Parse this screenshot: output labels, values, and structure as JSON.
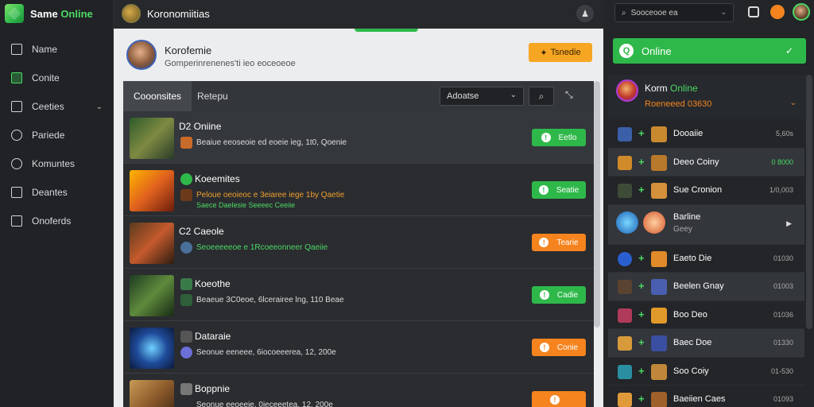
{
  "brand": {
    "name_part1": "Same ",
    "name_part2": "Online"
  },
  "sidebar": {
    "items": [
      {
        "label": "Name",
        "icon": "square-icon"
      },
      {
        "label": "Conite",
        "icon": "chart-icon"
      },
      {
        "label": "Ceeties",
        "icon": "home-icon",
        "has_chevron": true
      },
      {
        "label": "Pariede",
        "icon": "search-icon"
      },
      {
        "label": "Komuntes",
        "icon": "user-icon"
      },
      {
        "label": "Deantes",
        "icon": "document-icon"
      },
      {
        "label": "Onoferds",
        "icon": "phone-icon"
      }
    ]
  },
  "topbar": {
    "title": "Koronomiitias"
  },
  "profile": {
    "name": "Korofemie",
    "subtitle": "Gomperinrenenes'ti ieo eoceoeoe",
    "button_label": "Tsnedie"
  },
  "tabs": [
    {
      "label": "Cooonsites"
    },
    {
      "label": "Retepu"
    }
  ],
  "filter": {
    "select_value": "Adoatse"
  },
  "rows": [
    {
      "title": "D2 Oniine",
      "meta": "Beaiue eeoseoie ed eoeie ieg, 1t0, Qoenie",
      "meta2": "",
      "button": "Eetlo",
      "btn_color": "green",
      "selected": true
    },
    {
      "title": "Koeemites",
      "meta": "Peloue oeoieoc e 3eiaree iege 1by Qaetie",
      "meta2": "Saece Daelesie  Seeeec Ceeiie",
      "button": "Seatie",
      "btn_color": "green"
    },
    {
      "title": "C2 Caeole",
      "meta": "Seoeeeeeoe e 1Rcoeeonneer Qaeiie",
      "meta2": "",
      "button": "Tearie",
      "btn_color": "orange"
    },
    {
      "title": "Koeothe",
      "meta": "Beaeue 3C0eoe, 6lcerairee lng, 110 Beae",
      "meta2": "",
      "button": "Cadie",
      "btn_color": "green"
    },
    {
      "title": "Dataraie",
      "meta": "Seonue eeneee, 6iocoeeerea, 12, 200e",
      "meta2": "",
      "button": "Conie",
      "btn_color": "orange"
    },
    {
      "title": "Boppnie",
      "meta": "Seonue eeoeeie, 0ieceeetea, 12, 200e",
      "meta2": "",
      "button": "",
      "btn_color": "orange"
    }
  ],
  "right": {
    "search_value": "Sooceooe  ea",
    "online_label": "Online",
    "user": {
      "name_part1": "Korm ",
      "name_part2": "Online",
      "sub": "Roeneeed 03630"
    },
    "items": [
      {
        "name": "Dooaiie",
        "value": "5,60s"
      },
      {
        "name": "Deeo Coiny",
        "value": "0 8000",
        "green": true,
        "highlight": true
      },
      {
        "name": "Sue Cronion",
        "value": "1/0,003"
      },
      {
        "name": "Barline",
        "sub": "Geey",
        "tall": true
      },
      {
        "name": "Eaeto Die",
        "value": "01030"
      },
      {
        "name": "Beelen Gnay",
        "value": "01003",
        "highlight": true
      },
      {
        "name": "Boo Deo",
        "value": "01036"
      },
      {
        "name": "Baec Doe",
        "value": "01330",
        "highlight": true
      },
      {
        "name": "Soo Coiy",
        "value": "01-530"
      },
      {
        "name": "Baeiien Caes",
        "value": "01093"
      }
    ]
  },
  "colors": {
    "accent_green": "#2fb84a",
    "accent_orange": "#f5841f"
  }
}
